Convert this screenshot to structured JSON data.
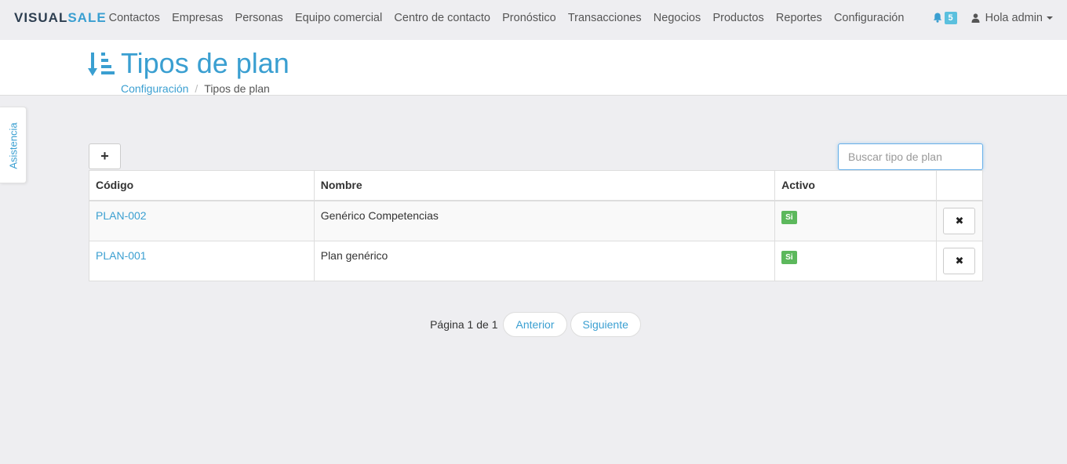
{
  "navbar": {
    "logo_main": "VISUAL",
    "logo_accent": "SALE",
    "items": [
      {
        "label": "Contactos"
      },
      {
        "label": "Empresas"
      },
      {
        "label": "Personas"
      },
      {
        "label": "Equipo comercial"
      },
      {
        "label": "Centro de contacto"
      },
      {
        "label": "Pronóstico"
      },
      {
        "label": "Transacciones"
      },
      {
        "label": "Negocios"
      },
      {
        "label": "Productos"
      },
      {
        "label": "Reportes"
      },
      {
        "label": "Configuración"
      }
    ],
    "notifications_count": "5",
    "user_label": "Hola admin"
  },
  "header": {
    "title": "Tipos de plan",
    "breadcrumb": {
      "parent": "Configuración",
      "current": "Tipos de plan"
    }
  },
  "side_tab": {
    "label": "Asistencia"
  },
  "toolbar": {
    "add_label": "+",
    "search_placeholder": "Buscar tipo de plan"
  },
  "table": {
    "columns": [
      "Código",
      "Nombre",
      "Activo",
      ""
    ],
    "rows": [
      {
        "code": "PLAN-002",
        "name": "Genérico Competencias",
        "active": "Si",
        "delete": "✖"
      },
      {
        "code": "PLAN-001",
        "name": "Plan genérico",
        "active": "Si",
        "delete": "✖"
      }
    ]
  },
  "pager": {
    "text": "Página 1 de 1",
    "prev": "Anterior",
    "next": "Siguiente"
  },
  "colors": {
    "accent": "#3a9fd1",
    "success": "#5cb85c",
    "badge": "#5bc0de"
  }
}
